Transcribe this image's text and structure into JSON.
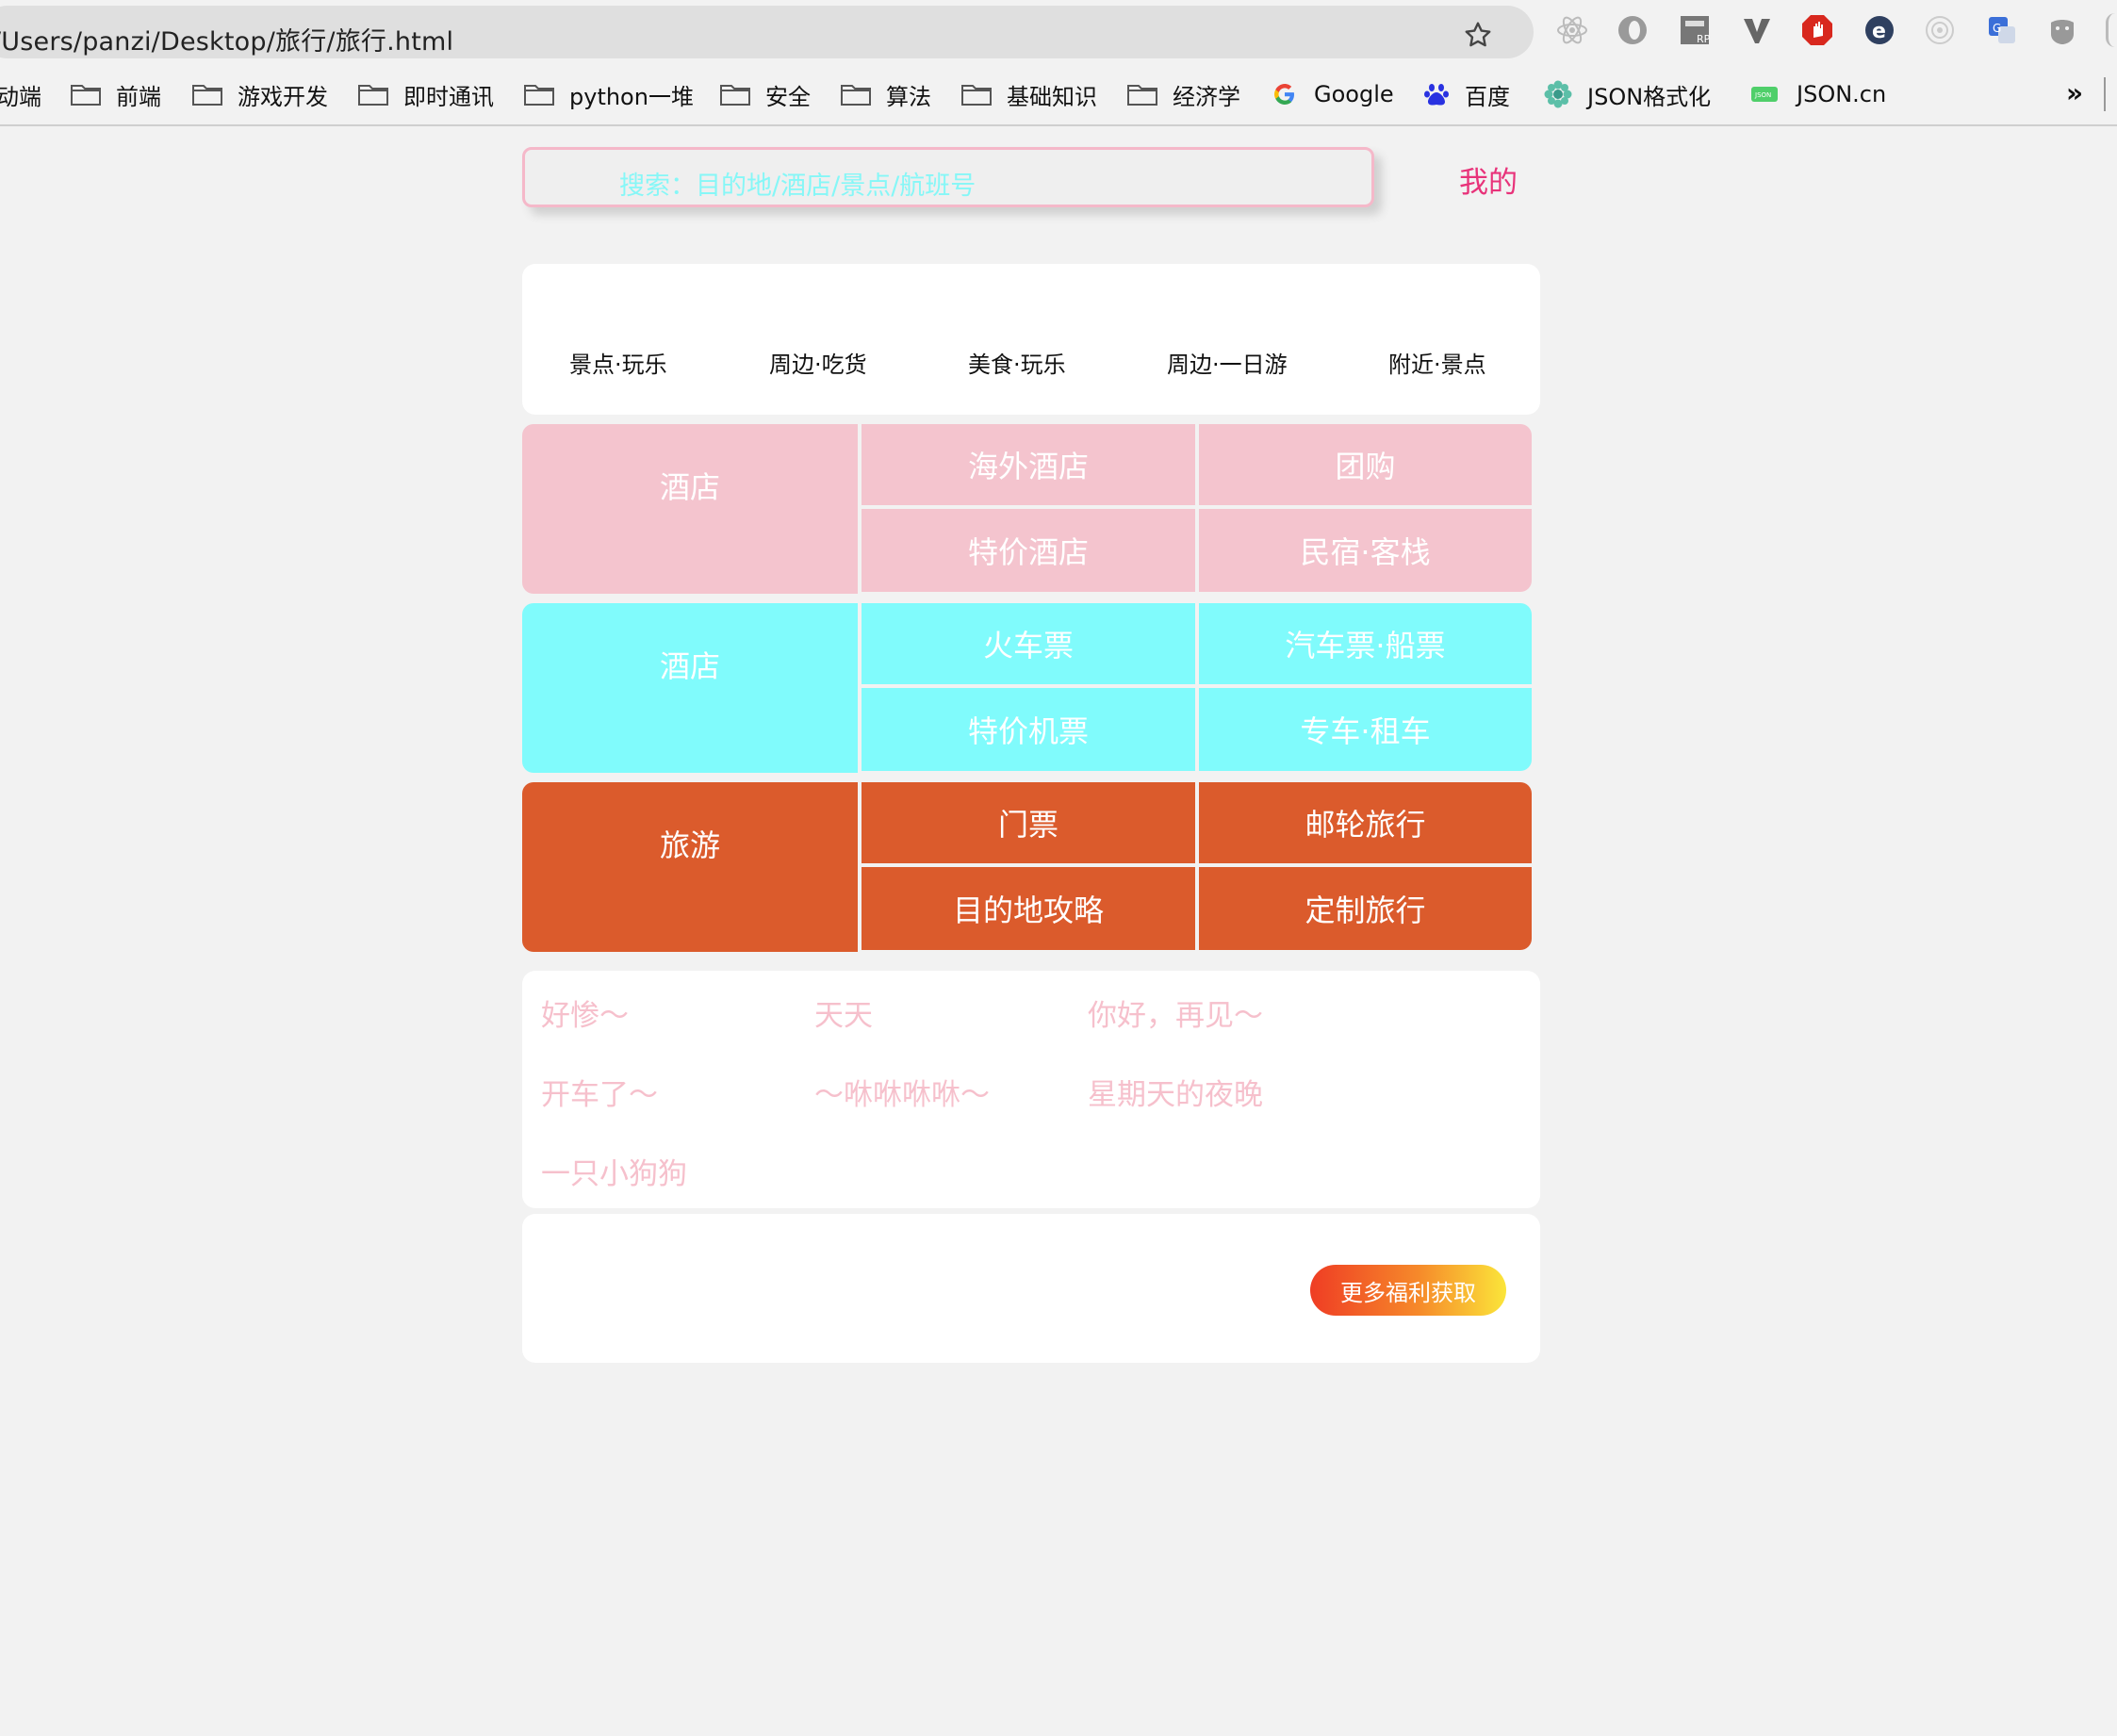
{
  "browser": {
    "url": "/Users/panzi/Desktop/旅行/旅行.html",
    "bookmarks": [
      "动端",
      "前端",
      "游戏开发",
      "即时通讯",
      "python一堆",
      "安全",
      "算法",
      "基础知识",
      "经济学",
      "Google",
      "百度",
      "JSON格式化",
      "JSON.cn"
    ],
    "more_label": "»",
    "extensions": [
      "react-icon",
      "opera-icon",
      "rp-icon",
      "v-icon",
      "adblock-icon",
      "ie-icon",
      "target-icon",
      "translate-icon",
      "ghost-icon"
    ]
  },
  "header": {
    "search_placeholder": "搜索：目的地/酒店/景点/航班号",
    "mine_label": "我的"
  },
  "nav": {
    "items": [
      "景点·玩乐",
      "周边·吃货",
      "美食·玩乐",
      "周边·一日游",
      "附近·景点"
    ]
  },
  "grid": {
    "rows": [
      {
        "main": "酒店",
        "cells": [
          "海外酒店",
          "团购",
          "特价酒店",
          "民宿·客栈"
        ]
      },
      {
        "main": "酒店",
        "cells": [
          "火车票",
          "汽车票·船票",
          "特价机票",
          "专车·租车"
        ]
      },
      {
        "main": "旅游",
        "cells": [
          "门票",
          "邮轮旅行",
          "目的地攻略",
          "定制旅行"
        ]
      }
    ]
  },
  "tags": [
    "好惨～",
    "天天",
    "你好，再见～",
    "开车了～",
    "～咻咻咻咻～",
    "星期天的夜晚",
    "一只小狗狗"
  ],
  "bonus": {
    "button_label": "更多福利获取"
  },
  "colors": {
    "pink": "#f4c4ce",
    "cyan": "#80fbfc",
    "orange": "#db5b2c",
    "accent": "#e8337a",
    "placeholder": "#86f7f7",
    "tag_text": "#f6c0cc"
  }
}
